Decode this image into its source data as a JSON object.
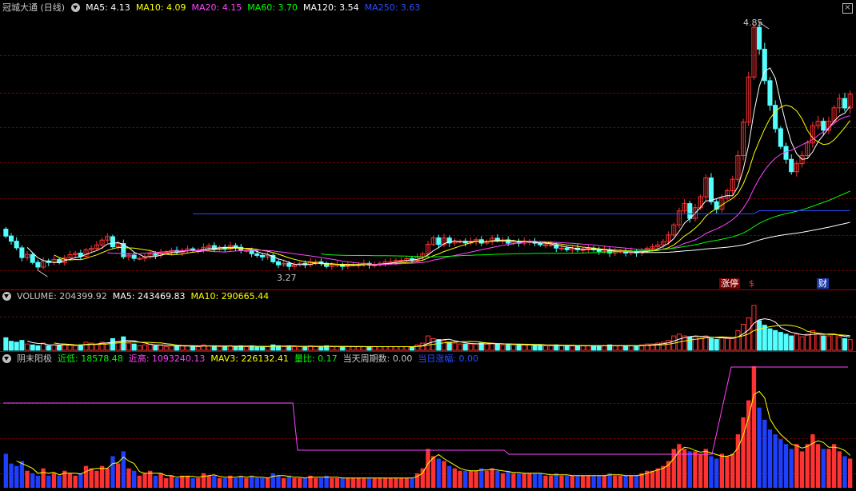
{
  "price_panel": {
    "title": "冠城大通 (日线)",
    "indicators": [
      {
        "label": "MA5: 4.13",
        "color": "#ffffff"
      },
      {
        "label": "MA10: 4.09",
        "color": "#ffff00"
      },
      {
        "label": "MA20: 4.15",
        "color": "#ff44ff"
      },
      {
        "label": "MA60: 3.70",
        "color": "#00ff00"
      },
      {
        "label": "MA120: 3.54",
        "color": "#ffffff"
      },
      {
        "label": "MA250: 3.63",
        "color": "#2a4dff"
      }
    ],
    "high_label": "4.85",
    "low_label": "3.27",
    "high_value": 4.85,
    "low_value": 3.27,
    "tags": [
      {
        "text": "涨停",
        "color": "#ffffff",
        "bg": "#7a0000"
      },
      {
        "text": "$",
        "color": "#ff3333",
        "bg": ""
      },
      {
        "text": "财",
        "color": "#ffffff",
        "bg": "#1d3aa8"
      }
    ],
    "close_icon": "close-icon"
  },
  "volume_panel": {
    "indicators": [
      {
        "label": "VOLUME: 204399.92",
        "color": "#c8c8c8"
      },
      {
        "label": "MA5: 243469.83",
        "color": "#ffffff"
      },
      {
        "label": "MA10: 290665.44",
        "color": "#ffff00"
      }
    ]
  },
  "bottom_panel": {
    "indicators": [
      {
        "label": "阴末阳极",
        "color": "#c8c8c8"
      },
      {
        "label": "近低: 18578.48",
        "color": "#00ff00"
      },
      {
        "label": "近高: 1093240.13",
        "color": "#ff44ff"
      },
      {
        "label": "MAV3: 226132.41",
        "color": "#ffff00"
      },
      {
        "label": "量比: 0.17",
        "color": "#00ff00"
      },
      {
        "label": "当天周期数: 0.00",
        "color": "#c8c8c8"
      },
      {
        "label": "当日涨幅: 0.00",
        "color": "#2a4dff"
      }
    ]
  },
  "colors": {
    "up": "#ff3232",
    "down": "#54ffff",
    "blue_bar": "#1f3fff",
    "grid": "#700000",
    "separator": "#b00000"
  },
  "chart_data": {
    "type": "candlestick",
    "start_close": 3.78,
    "close_returns": [
      -0.02,
      -0.015,
      -0.02,
      -0.03,
      0.01,
      -0.025,
      -0.015,
      0.02,
      -0.005,
      0.01,
      -0.01,
      0.015,
      0.01,
      0.005,
      -0.01,
      0.02,
      0.005,
      0.01,
      0.015,
      0.01,
      -0.03,
      0.01,
      -0.04,
      0.005,
      -0.01,
      0,
      0.005,
      0.01,
      -0.005,
      0.01,
      0,
      0.005,
      -0.005,
      0.005,
      0.005,
      -0.005,
      0,
      0.01,
      0.005,
      -0.01,
      0.005,
      -0.005,
      0.01,
      -0.005,
      -0.01,
      0,
      -0.01,
      -0.005,
      -0.005,
      0.005,
      -0.02,
      -0.01,
      0.005,
      -0.01,
      0.005,
      0.005,
      -0.005,
      0.01,
      0,
      -0.005,
      -0.01,
      0.005,
      0,
      -0.005,
      0.005,
      0,
      0,
      0.005,
      -0.005,
      0,
      0.005,
      0.005,
      0,
      0.005,
      0,
      0.005,
      -0.005,
      0.01,
      0.01,
      0.03,
      0.02,
      -0.02,
      0.02,
      -0.015,
      0.005,
      0,
      -0.005,
      0.005,
      0.005,
      -0.01,
      0.005,
      0.01,
      -0.005,
      0,
      -0.01,
      0.005,
      -0.005,
      0.005,
      0,
      -0.005,
      -0.005,
      0,
      0,
      -0.01,
      0,
      -0.005,
      0.005,
      -0.005,
      0,
      0.005,
      -0.005,
      -0.005,
      0.005,
      -0.01,
      0.005,
      0,
      -0.005,
      0.005,
      -0.005,
      0.005,
      0.01,
      0.005,
      0.005,
      0.01,
      0.02,
      0.03,
      0.04,
      0.02,
      -0.04,
      0.03,
      0.03,
      0.05,
      -0.06,
      -0.02,
      0.03,
      0.02,
      0.03,
      0.06,
      0.08,
      0.1,
      0.1,
      -0.04,
      -0.06,
      -0.05,
      -0.05,
      -0.04,
      -0.03,
      -0.03,
      0.02,
      0.02,
      0.03,
      0.04,
      0.01,
      -0.02,
      0.02,
      0.03,
      0.02,
      -0.02,
      0.03
    ],
    "volume": [
      1.4,
      1.0,
      0.9,
      1.1,
      0.7,
      0.6,
      0.5,
      0.8,
      0.5,
      0.6,
      0.5,
      0.7,
      0.6,
      0.5,
      0.6,
      0.9,
      0.8,
      0.7,
      0.9,
      0.8,
      1.3,
      1.0,
      1.5,
      0.8,
      0.7,
      0.5,
      0.6,
      0.7,
      0.5,
      0.6,
      0.4,
      0.5,
      0.4,
      0.5,
      0.5,
      0.4,
      0.4,
      0.6,
      0.5,
      0.5,
      0.4,
      0.4,
      0.5,
      0.4,
      0.5,
      0.4,
      0.5,
      0.4,
      0.4,
      0.4,
      0.6,
      0.5,
      0.4,
      0.5,
      0.4,
      0.4,
      0.4,
      0.5,
      0.4,
      0.4,
      0.5,
      0.4,
      0.4,
      0.4,
      0.4,
      0.4,
      0.4,
      0.4,
      0.4,
      0.4,
      0.4,
      0.4,
      0.4,
      0.4,
      0.4,
      0.4,
      0.4,
      0.6,
      0.8,
      1.6,
      1.3,
      1.2,
      1.1,
      0.9,
      0.8,
      0.7,
      0.7,
      0.7,
      0.7,
      0.8,
      0.7,
      0.8,
      0.7,
      0.6,
      0.7,
      0.6,
      0.6,
      0.6,
      0.6,
      0.6,
      0.6,
      0.5,
      0.5,
      0.6,
      0.5,
      0.5,
      0.5,
      0.5,
      0.5,
      0.5,
      0.5,
      0.5,
      0.5,
      0.6,
      0.5,
      0.5,
      0.5,
      0.5,
      0.5,
      0.6,
      0.7,
      0.7,
      0.8,
      0.9,
      1.1,
      1.6,
      1.8,
      1.6,
      1.5,
      1.5,
      1.4,
      1.6,
      1.3,
      1.2,
      1.4,
      1.3,
      1.4,
      2.2,
      2.9,
      3.6,
      5.0,
      3.3,
      2.8,
      2.4,
      2.2,
      2.0,
      1.8,
      1.6,
      1.8,
      1.5,
      1.8,
      2.2,
      1.8,
      1.6,
      1.6,
      1.8,
      1.5,
      1.3,
      1.2
    ]
  }
}
